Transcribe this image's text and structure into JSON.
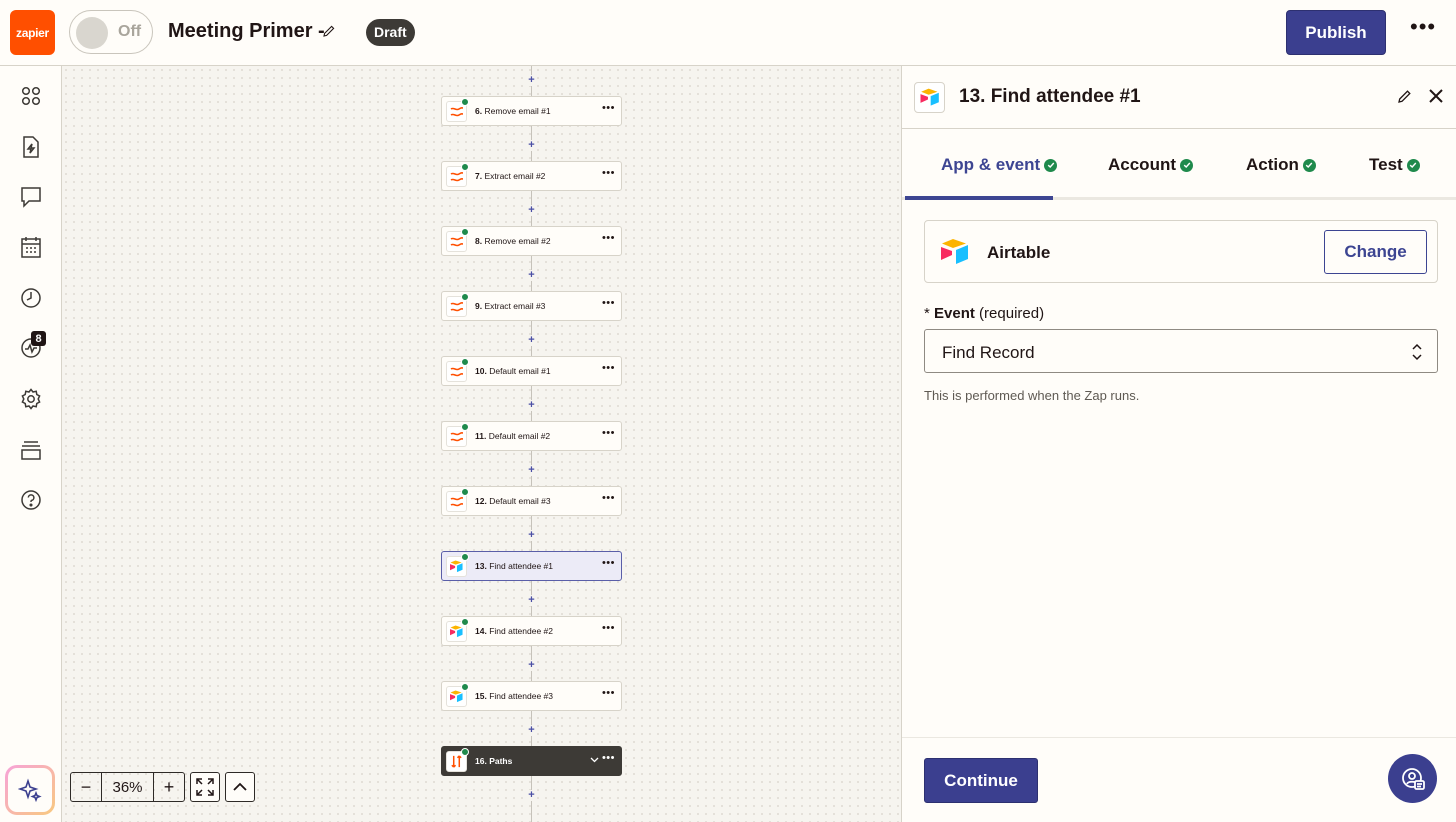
{
  "header": {
    "logo_text": "zapier",
    "toggle_label": "Off",
    "zap_title": "Meeting Primer -",
    "status_badge": "Draft",
    "publish_label": "Publish"
  },
  "sidebar": {
    "items": [
      {
        "name": "apps",
        "icon": "apps-grid-icon"
      },
      {
        "name": "zaps",
        "icon": "zap-file-icon"
      },
      {
        "name": "chat",
        "icon": "chat-icon"
      },
      {
        "name": "tables",
        "icon": "calendar-table-icon"
      },
      {
        "name": "history",
        "icon": "clock-icon"
      },
      {
        "name": "activity",
        "icon": "activity-icon",
        "badge": "8"
      },
      {
        "name": "settings",
        "icon": "gear-icon"
      },
      {
        "name": "templates",
        "icon": "stack-icon"
      },
      {
        "name": "help",
        "icon": "question-icon"
      }
    ],
    "ai_button_icon": "sparkle-icon"
  },
  "canvas": {
    "steps": [
      {
        "num": "6.",
        "label": "Remove email #1",
        "app": "formatter"
      },
      {
        "num": "7.",
        "label": "Extract email #2",
        "app": "formatter"
      },
      {
        "num": "8.",
        "label": "Remove email #2",
        "app": "formatter"
      },
      {
        "num": "9.",
        "label": "Extract email #3",
        "app": "formatter"
      },
      {
        "num": "10.",
        "label": "Default email #1",
        "app": "formatter"
      },
      {
        "num": "11.",
        "label": "Default email #2",
        "app": "formatter"
      },
      {
        "num": "12.",
        "label": "Default email #3",
        "app": "formatter"
      },
      {
        "num": "13.",
        "label": "Find attendee #1",
        "app": "airtable",
        "selected": true
      },
      {
        "num": "14.",
        "label": "Find attendee #2",
        "app": "airtable"
      },
      {
        "num": "15.",
        "label": "Find attendee #3",
        "app": "airtable"
      },
      {
        "num": "16.",
        "label": "Paths",
        "app": "paths",
        "dark": true
      }
    ],
    "plus_symbol": "+",
    "zoom": {
      "value": "36%",
      "minus": "−",
      "plus": "+"
    }
  },
  "panel": {
    "title": "13. Find attendee #1",
    "tabs": [
      {
        "label": "App & event",
        "active": true
      },
      {
        "label": "Account"
      },
      {
        "label": "Action"
      },
      {
        "label": "Test"
      }
    ],
    "app_name": "Airtable",
    "change_label": "Change",
    "event": {
      "required_mark": "*",
      "label": "Event",
      "note": "(required)",
      "value": "Find Record",
      "help": "This is performed when the Zap runs."
    },
    "continue_label": "Continue"
  },
  "colors": {
    "brand_orange": "#ff4f00",
    "primary": "#3b3f8f",
    "success": "#1f8a4c"
  }
}
